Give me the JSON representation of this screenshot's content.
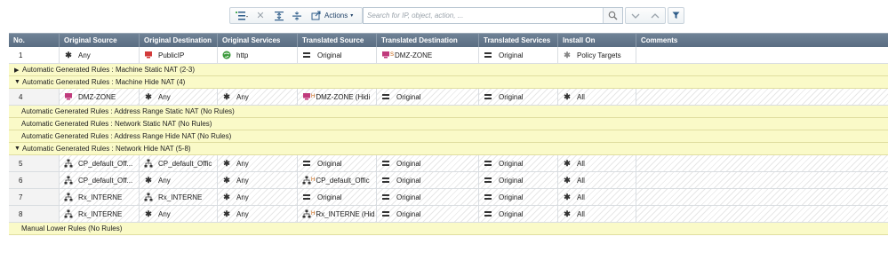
{
  "toolbar": {
    "actions_label": "Actions",
    "search_placeholder": "Search for IP, object, action, ..."
  },
  "columns": [
    "No.",
    "Original Source",
    "Original Destination",
    "Original Services",
    "Translated Source",
    "Translated Destination",
    "Translated Services",
    "Install On",
    "Comments"
  ],
  "rule1": {
    "no": "1",
    "src": "Any",
    "dst": "PublicIP",
    "svc": "http",
    "tsrc": "Original",
    "tdst_prefix": "S",
    "tdst": "DMZ-ZONE",
    "tsvc": "Original",
    "install": "Policy Targets"
  },
  "sections": {
    "s1": "Automatic Generated Rules : Machine Static NAT (2-3)",
    "s2": "Automatic Generated Rules : Machine Hide NAT (4)",
    "s3": "Automatic Generated Rules : Address Range Static NAT (No Rules)",
    "s4": "Automatic Generated Rules : Network Static NAT (No Rules)",
    "s5": "Automatic Generated Rules : Address Range Hide NAT (No Rules)",
    "s6": "Automatic Generated Rules : Network Hide NAT (5-8)",
    "s7": "Manual Lower Rules (No Rules)"
  },
  "rule4": {
    "no": "4",
    "src": "DMZ-ZONE",
    "dst": "Any",
    "svc": "Any",
    "tsrc_prefix": "H",
    "tsrc": "DMZ-ZONE (Hidi",
    "tdst": "Original",
    "tsvc": "Original",
    "install": "All"
  },
  "rule5": {
    "no": "5",
    "src": "CP_default_Off...",
    "dst": "CP_default_Offic",
    "svc": "Any",
    "tsrc": "Original",
    "tdst": "Original",
    "tsvc": "Original",
    "install": "All"
  },
  "rule6": {
    "no": "6",
    "src": "CP_default_Off...",
    "dst": "Any",
    "svc": "Any",
    "tsrc_prefix": "H",
    "tsrc": "CP_default_Offic",
    "tdst": "Original",
    "tsvc": "Original",
    "install": "All"
  },
  "rule7": {
    "no": "7",
    "src": "Rx_INTERNE",
    "dst": "Rx_INTERNE",
    "svc": "Any",
    "tsrc": "Original",
    "tdst": "Original",
    "tsvc": "Original",
    "install": "All"
  },
  "rule8": {
    "no": "8",
    "src": "Rx_INTERNE",
    "dst": "Any",
    "svc": "Any",
    "tsrc_prefix": "H",
    "tsrc": "Rx_INTERNE (Hid",
    "tdst": "Original",
    "tsvc": "Original",
    "install": "All"
  },
  "icons": {
    "any": "asterisk-icon",
    "host": "host-icon",
    "network": "network-icon",
    "service": "globe-icon",
    "original": "equals-icon",
    "install": "asterisk-icon"
  },
  "colors": {
    "header_bg": "#5a6d82",
    "section_bg": "#fafac8",
    "host_icon": "#c03a7c",
    "publicip_icon": "#d23a3a",
    "service_icon": "#3c9a3c"
  }
}
